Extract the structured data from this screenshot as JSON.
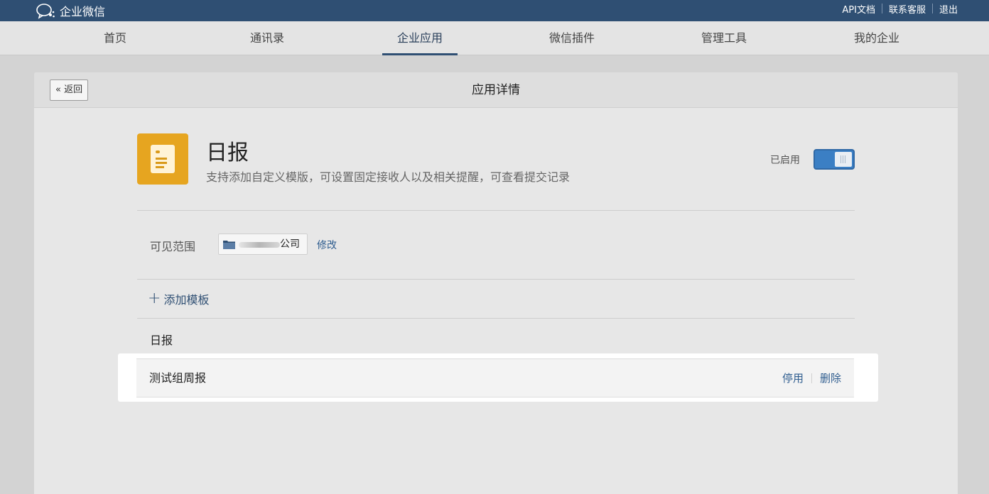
{
  "topbar": {
    "logo_text": "企业微信",
    "links": [
      "API文档",
      "联系客服",
      "退出"
    ]
  },
  "nav": {
    "items": [
      "首页",
      "通讯录",
      "企业应用",
      "微信插件",
      "管理工具",
      "我的企业"
    ],
    "active": "企业应用"
  },
  "page": {
    "back_label": "« 返回",
    "title": "应用详情"
  },
  "app": {
    "name": "日报",
    "description": "支持添加自定义模版，可设置固定接收人以及相关提醒，可查看提交记录",
    "status_label": "已启用",
    "enabled": true,
    "icon_color": "#e6a520",
    "icon": "document-icon"
  },
  "scope": {
    "label": "可见范围",
    "company_suffix": "公司",
    "modify_label": "修改"
  },
  "templates": {
    "add_label": "添加模板",
    "section_name": "日报",
    "rows": [
      {
        "name": "测试组周报",
        "disable_label": "停用",
        "delete_label": "删除"
      }
    ]
  },
  "colors": {
    "topbar": "#2f4f73",
    "accent": "#3b7fc4",
    "link": "#2f5d8f"
  }
}
